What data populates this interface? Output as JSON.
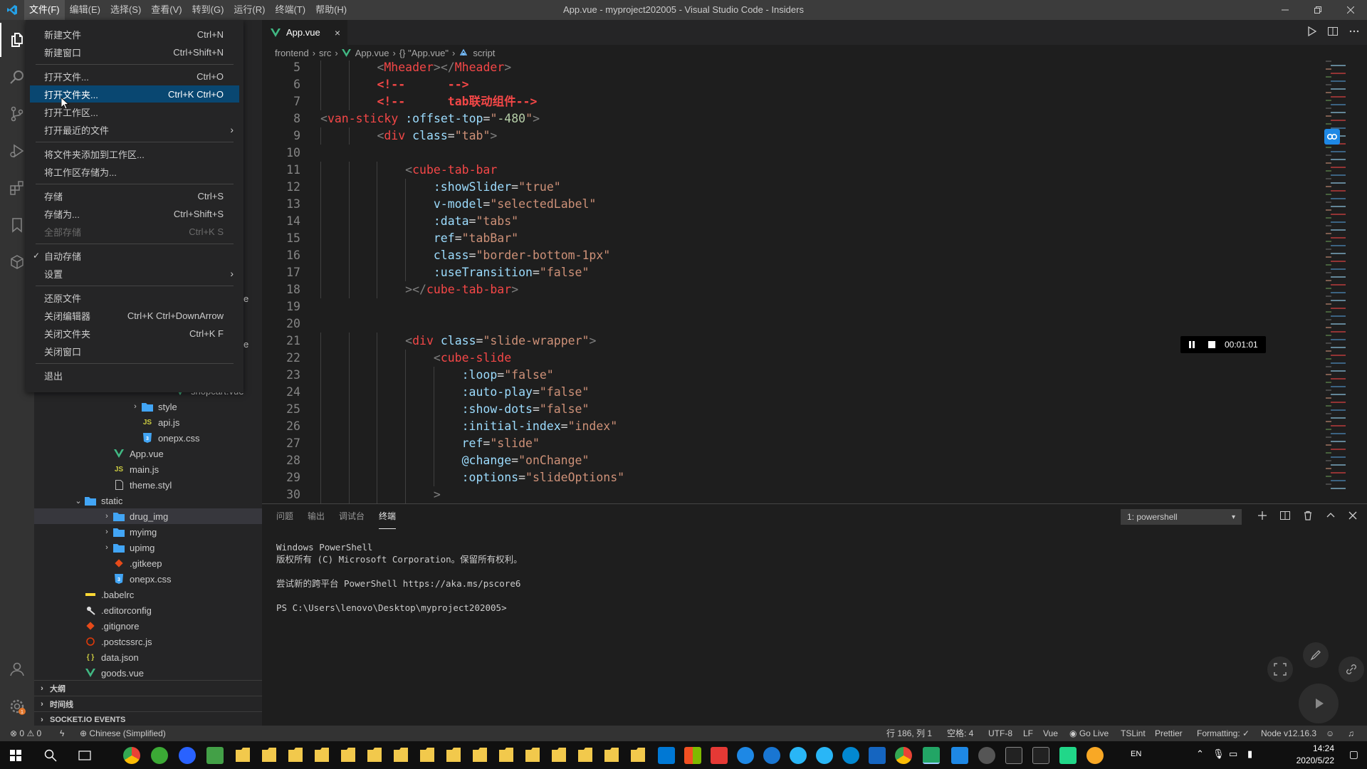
{
  "window": {
    "title": "App.vue - myproject202005 - Visual Studio Code - Insiders",
    "menus": [
      "文件(F)",
      "编辑(E)",
      "选择(S)",
      "查看(V)",
      "转到(G)",
      "运行(R)",
      "终端(T)",
      "帮助(H)"
    ]
  },
  "file_menu": {
    "items": [
      {
        "label": "新建文件",
        "key": "Ctrl+N"
      },
      {
        "label": "新建窗口",
        "key": "Ctrl+Shift+N"
      },
      {
        "label": "打开文件...",
        "key": "Ctrl+O"
      },
      {
        "label": "打开文件夹...",
        "key": "Ctrl+K Ctrl+O"
      },
      {
        "label": "打开工作区...",
        "key": ""
      },
      {
        "label": "打开最近的文件",
        "key": ""
      },
      {
        "label": "将文件夹添加到工作区...",
        "key": ""
      },
      {
        "label": "将工作区存储为...",
        "key": ""
      },
      {
        "label": "存储",
        "key": "Ctrl+S"
      },
      {
        "label": "存储为...",
        "key": "Ctrl+Shift+S"
      },
      {
        "label": "全部存储",
        "key": "Ctrl+K S"
      },
      {
        "label": "自动存储",
        "key": ""
      },
      {
        "label": "设置",
        "key": ""
      },
      {
        "label": "还原文件",
        "key": ""
      },
      {
        "label": "关闭编辑器",
        "key": "Ctrl+K Ctrl+DownArrow"
      },
      {
        "label": "关闭文件夹",
        "key": "Ctrl+K F"
      },
      {
        "label": "关闭窗口",
        "key": ""
      },
      {
        "label": "退出",
        "key": ""
      }
    ]
  },
  "explorer": {
    "partial_items": [
      "e",
      "e",
      "shopcart.vue"
    ],
    "items": [
      {
        "label": "style",
        "type": "folder"
      },
      {
        "label": "api.js",
        "type": "js"
      },
      {
        "label": "onepx.css",
        "type": "css"
      },
      {
        "label": "App.vue",
        "type": "vue"
      },
      {
        "label": "main.js",
        "type": "js"
      },
      {
        "label": "theme.styl",
        "type": "file"
      },
      {
        "label": "static",
        "type": "folder-open"
      },
      {
        "label": "drug_img",
        "type": "folder"
      },
      {
        "label": "myimg",
        "type": "folder"
      },
      {
        "label": "upimg",
        "type": "folder"
      },
      {
        "label": ".gitkeep",
        "type": "git"
      },
      {
        "label": "onepx.css",
        "type": "css"
      },
      {
        "label": ".babelrc",
        "type": "babel"
      },
      {
        "label": ".editorconfig",
        "type": "config"
      },
      {
        "label": ".gitignore",
        "type": "git"
      },
      {
        "label": ".postcssrc.js",
        "type": "postcss"
      },
      {
        "label": "data.json",
        "type": "json"
      },
      {
        "label": "goods.vue",
        "type": "vue"
      }
    ],
    "panels": [
      "大纲",
      "时间线",
      "SOCKET.IO EVENTS"
    ]
  },
  "editor": {
    "tab": "App.vue",
    "breadcrumb": [
      "frontend",
      "src",
      "App.vue",
      "{} \"App.vue\"",
      "script"
    ],
    "line_numbers": [
      "5",
      "6",
      "7",
      "8",
      "9",
      "10",
      "11",
      "12",
      "13",
      "14",
      "15",
      "16",
      "17",
      "18",
      "19",
      "20",
      "21",
      "22",
      "23",
      "24",
      "25",
      "26",
      "27",
      "28",
      "29",
      "30"
    ],
    "lines": [
      [
        [
          "t-punct",
          "<"
        ],
        [
          "t-tag",
          "Mheader"
        ],
        [
          "t-punct",
          "></"
        ],
        [
          "t-tag",
          "Mheader"
        ],
        [
          "t-punct",
          ">"
        ]
      ],
      [
        [
          "t-cmt",
          "<!--      -->"
        ]
      ],
      [
        [
          "t-cmt",
          "<!--      tab联动组件-->"
        ]
      ],
      [
        [
          "t-punct",
          "<"
        ],
        [
          "t-tag",
          "van-sticky"
        ],
        [
          "t-txt",
          " "
        ],
        [
          "t-attr",
          ":offset-top"
        ],
        [
          "t-txt",
          "="
        ],
        [
          "t-str",
          "\""
        ],
        [
          "t-num",
          "-480"
        ],
        [
          "t-str",
          "\""
        ],
        [
          "t-punct",
          ">"
        ]
      ],
      [
        [
          "t-punct",
          "<"
        ],
        [
          "t-tag",
          "div"
        ],
        [
          "t-txt",
          " "
        ],
        [
          "t-attr",
          "class"
        ],
        [
          "t-txt",
          "="
        ],
        [
          "t-str",
          "\"tab\""
        ],
        [
          "t-punct",
          ">"
        ]
      ],
      [],
      [
        [
          "t-punct",
          "<"
        ],
        [
          "t-tag",
          "cube-tab-bar"
        ]
      ],
      [
        [
          "t-attr",
          ":showSlider"
        ],
        [
          "t-txt",
          "="
        ],
        [
          "t-str",
          "\"true\""
        ]
      ],
      [
        [
          "t-attr",
          "v-model"
        ],
        [
          "t-txt",
          "="
        ],
        [
          "t-str",
          "\"selectedLabel\""
        ]
      ],
      [
        [
          "t-attr",
          ":data"
        ],
        [
          "t-txt",
          "="
        ],
        [
          "t-str",
          "\"tabs\""
        ]
      ],
      [
        [
          "t-attr",
          "ref"
        ],
        [
          "t-txt",
          "="
        ],
        [
          "t-str",
          "\"tabBar\""
        ]
      ],
      [
        [
          "t-attr",
          "class"
        ],
        [
          "t-txt",
          "="
        ],
        [
          "t-str",
          "\"border-bottom-1px\""
        ]
      ],
      [
        [
          "t-attr",
          ":useTransition"
        ],
        [
          "t-txt",
          "="
        ],
        [
          "t-str",
          "\"false\""
        ]
      ],
      [
        [
          "t-punct",
          "></"
        ],
        [
          "t-tag",
          "cube-tab-bar"
        ],
        [
          "t-punct",
          ">"
        ]
      ],
      [],
      [],
      [
        [
          "t-punct",
          "<"
        ],
        [
          "t-tag",
          "div"
        ],
        [
          "t-txt",
          " "
        ],
        [
          "t-attr",
          "class"
        ],
        [
          "t-txt",
          "="
        ],
        [
          "t-str",
          "\"slide-wrapper\""
        ],
        [
          "t-punct",
          ">"
        ]
      ],
      [
        [
          "t-punct",
          "<"
        ],
        [
          "t-tag",
          "cube-slide"
        ]
      ],
      [
        [
          "t-attr",
          ":loop"
        ],
        [
          "t-txt",
          "="
        ],
        [
          "t-str",
          "\"false\""
        ]
      ],
      [
        [
          "t-attr",
          ":auto-play"
        ],
        [
          "t-txt",
          "="
        ],
        [
          "t-str",
          "\"false\""
        ]
      ],
      [
        [
          "t-attr",
          ":show-dots"
        ],
        [
          "t-txt",
          "="
        ],
        [
          "t-str",
          "\"false\""
        ]
      ],
      [
        [
          "t-attr",
          ":initial-index"
        ],
        [
          "t-txt",
          "="
        ],
        [
          "t-str",
          "\"index\""
        ]
      ],
      [
        [
          "t-attr",
          "ref"
        ],
        [
          "t-txt",
          "="
        ],
        [
          "t-str",
          "\"slide\""
        ]
      ],
      [
        [
          "t-attr",
          "@change"
        ],
        [
          "t-txt",
          "="
        ],
        [
          "t-str",
          "\"onChange\""
        ]
      ],
      [
        [
          "t-attr",
          ":options"
        ],
        [
          "t-txt",
          "="
        ],
        [
          "t-str",
          "\"slideOptions\""
        ]
      ],
      [
        [
          "t-punct",
          ">"
        ]
      ]
    ],
    "indent_levels": [
      2,
      2,
      2,
      0,
      2,
      0,
      3,
      4,
      4,
      4,
      4,
      4,
      4,
      3,
      0,
      0,
      3,
      4,
      5,
      5,
      5,
      5,
      5,
      5,
      5,
      4
    ]
  },
  "recorder": {
    "time": "00:01:01"
  },
  "panel": {
    "tabs": [
      "问题",
      "输出",
      "调试台",
      "终端"
    ],
    "terminal_select": "1: powershell",
    "terminal_lines": [
      "Windows PowerShell",
      "版权所有 (C) Microsoft Corporation。保留所有权利。",
      "",
      "尝试新的跨平台 PowerShell https://aka.ms/pscore6",
      "",
      "PS C:\\Users\\lenovo\\Desktop\\myproject202005>"
    ]
  },
  "statusbar": {
    "errors": "0",
    "warnings": "0",
    "language_pack": "Chinese (Simplified)",
    "position": "行 186, 列 1",
    "spaces": "空格: 4",
    "encoding": "UTF-8",
    "eol": "LF",
    "language": "Vue",
    "golive": "Go Live",
    "tslint": "TSLint",
    "prettier": "Prettier",
    "formatting": "Formatting: ✓",
    "node": "Node v12.16.3"
  },
  "taskbar": {
    "ime": "EN",
    "time": "14:24",
    "date": "2020/5/22"
  },
  "colors": {
    "accent_blue": "#094771",
    "titlebar": "#3c3c3c",
    "tag_red": "#f44747",
    "string_orange": "#ce9178",
    "attr_blue": "#9cdcfe"
  }
}
